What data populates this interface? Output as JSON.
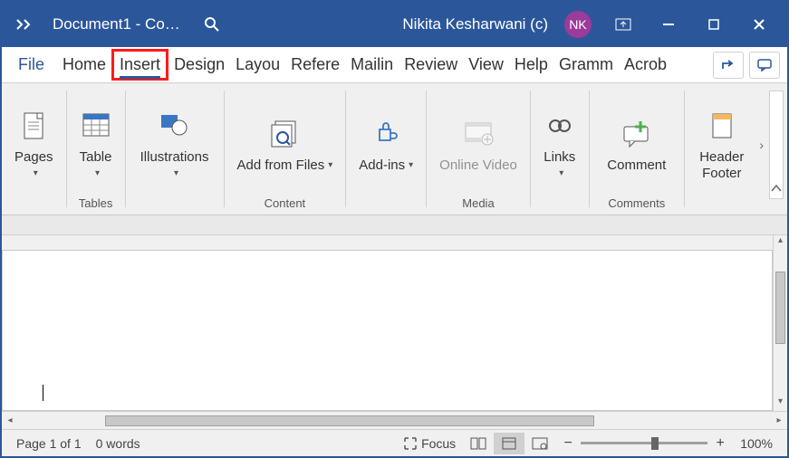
{
  "titlebar": {
    "document_title": "Document1  -  Co…",
    "user_name": "Nikita Kesharwani (c)",
    "avatar_initials": "NK"
  },
  "tabs": {
    "file": "File",
    "items": [
      "Home",
      "Insert",
      "Design",
      "Layou",
      "Refere",
      "Mailin",
      "Review",
      "View",
      "Help",
      "Gramm",
      "Acrob"
    ],
    "selected_index": 1
  },
  "ribbon": {
    "pages": {
      "label": "Pages"
    },
    "tables": {
      "group_label": "Tables",
      "table": "Table"
    },
    "illustrations": {
      "label": "Illustrations"
    },
    "content": {
      "group_label": "Content",
      "add_from_files": "Add from Files"
    },
    "addins": {
      "label": "Add-ins"
    },
    "media": {
      "group_label": "Media",
      "online_video": "Online Video"
    },
    "links": {
      "label": "Links"
    },
    "comments": {
      "group_label": "Comments",
      "comment": "Comment"
    },
    "header_footer": {
      "label": "Header Footer"
    }
  },
  "statusbar": {
    "page_info": "Page 1 of 1",
    "word_count": "0 words",
    "focus": "Focus",
    "zoom_label": "100%"
  }
}
